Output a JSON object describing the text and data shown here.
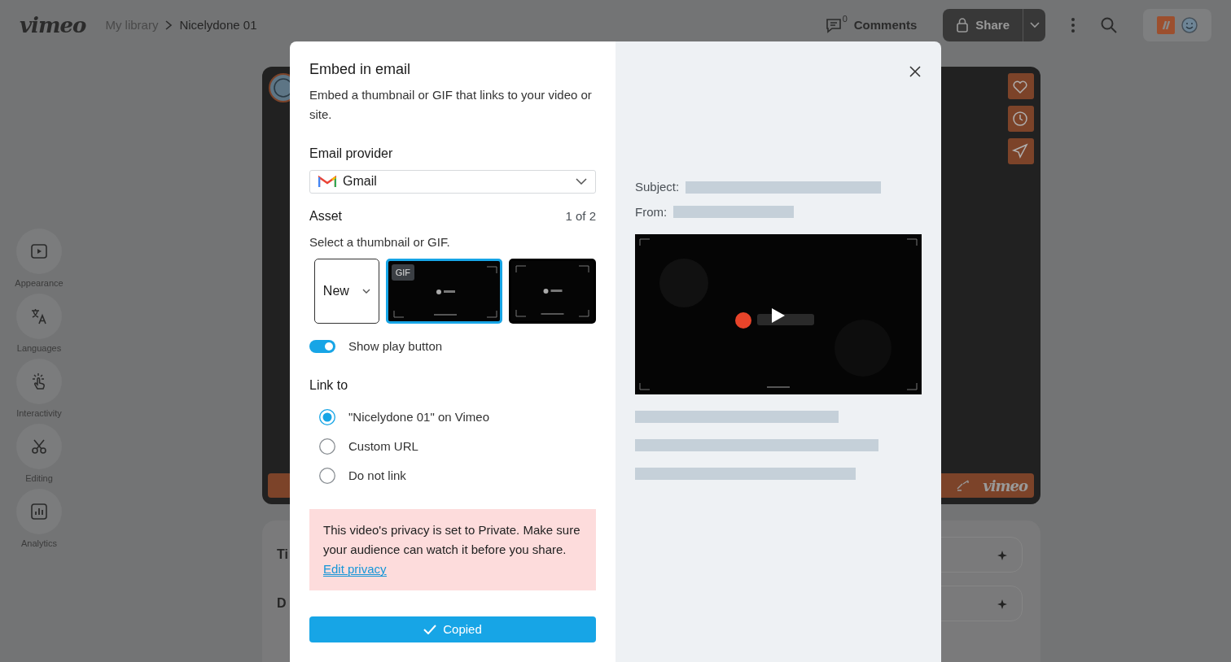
{
  "topbar": {
    "logo": "vimeo",
    "breadcrumb": [
      "My library",
      "Nicelydone 01"
    ],
    "comments_count": "0",
    "comments_label": "Comments",
    "share_label": "Share"
  },
  "sidebar": {
    "items": [
      {
        "label": "Appearance"
      },
      {
        "label": "Languages"
      },
      {
        "label": "Interactivity"
      },
      {
        "label": "Editing"
      },
      {
        "label": "Analytics"
      }
    ]
  },
  "player": {
    "logo": "vimeo"
  },
  "details": {
    "fields": [
      {
        "label": "Ti"
      },
      {
        "label": "D"
      }
    ]
  },
  "modal": {
    "title": "Embed in email",
    "description": "Embed a thumbnail or GIF that links to your video or site.",
    "provider_label": "Email provider",
    "provider": "Gmail",
    "asset_label": "Asset",
    "asset_count": "1 of 2",
    "asset_hint": "Select a thumbnail or GIF.",
    "assets": [
      {
        "kind": "new",
        "label": "New",
        "selected": false
      },
      {
        "kind": "gif",
        "badge": "GIF",
        "selected": true
      },
      {
        "kind": "thumbnail",
        "selected": false
      }
    ],
    "show_play_button": {
      "label": "Show play button",
      "on": true
    },
    "link_label": "Link to",
    "link_options": [
      {
        "label": "\"Nicelydone 01\" on Vimeo",
        "selected": true
      },
      {
        "label": "Custom URL",
        "selected": false
      },
      {
        "label": "Do not link",
        "selected": false
      }
    ],
    "notice": {
      "text": "This video's privacy is set to Private. Make sure your audience can watch it before you share.",
      "link": "Edit privacy"
    },
    "submit": "Copied",
    "preview": {
      "subject_label": "Subject:",
      "from_label": "From:"
    }
  }
}
